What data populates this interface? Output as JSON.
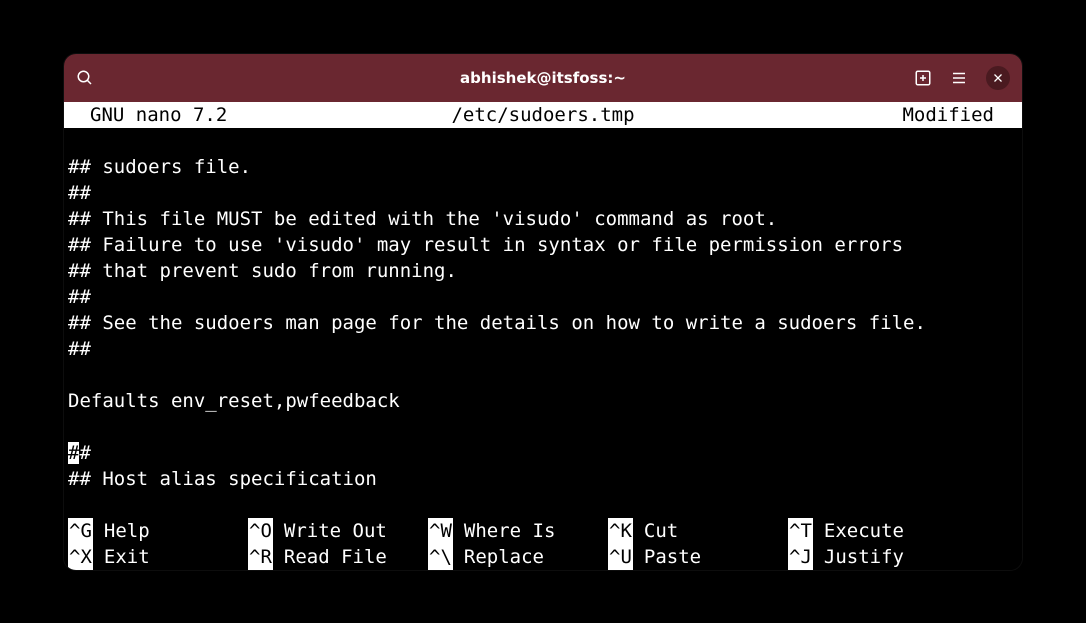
{
  "window": {
    "title": "abhishek@itsfoss:~"
  },
  "nano": {
    "header": {
      "app": "GNU nano 7.2",
      "file": "/etc/sudoers.tmp",
      "status": "Modified"
    },
    "lines": [
      "## sudoers file.",
      "##",
      "## This file MUST be edited with the 'visudo' command as root.",
      "## Failure to use 'visudo' may result in syntax or file permission errors",
      "## that prevent sudo from running.",
      "##",
      "## See the sudoers man page for the details on how to write a sudoers file.",
      "##",
      "",
      "Defaults env_reset,pwfeedback",
      ""
    ],
    "cursor_line_prefix": "#",
    "cursor_line_suffix": "#",
    "after_cursor_lines": [
      "## Host alias specification"
    ],
    "footer": {
      "row1": [
        {
          "key": "^G",
          "label": "Help"
        },
        {
          "key": "^O",
          "label": "Write Out"
        },
        {
          "key": "^W",
          "label": "Where Is"
        },
        {
          "key": "^K",
          "label": "Cut"
        },
        {
          "key": "^T",
          "label": "Execute"
        }
      ],
      "row2": [
        {
          "key": "^X",
          "label": "Exit"
        },
        {
          "key": "^R",
          "label": "Read File"
        },
        {
          "key": "^\\",
          "label": "Replace"
        },
        {
          "key": "^U",
          "label": "Paste"
        },
        {
          "key": "^J",
          "label": "Justify"
        }
      ]
    }
  }
}
